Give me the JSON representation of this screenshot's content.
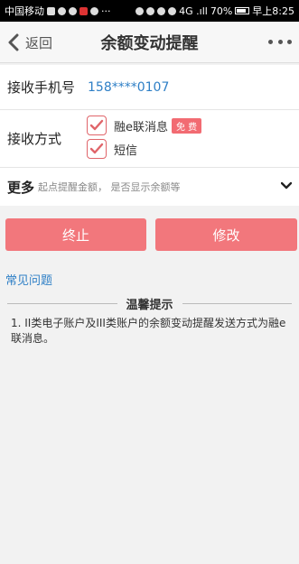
{
  "status_bar": {
    "carrier": "中国移动",
    "more": "···",
    "signal": "4G .ıll",
    "battery": "70%",
    "time": "早上8:25"
  },
  "nav": {
    "back_label": "返回",
    "title": "余额变动提醒",
    "more_icon": "more-dots-icon"
  },
  "phone": {
    "label": "接收手机号",
    "value": "158****0107"
  },
  "method": {
    "label": "接收方式",
    "options": [
      {
        "label": "融e联消息",
        "badge": "免 费",
        "checked": true
      },
      {
        "label": "短信",
        "checked": true
      }
    ]
  },
  "more": {
    "label": "更多",
    "hint": "起点提醒金额， 是否显示余额等"
  },
  "buttons": {
    "stop": "终止",
    "edit": "修改"
  },
  "faq": "常见问题",
  "tips": {
    "title": "温馨提示",
    "items": [
      "1. II类电子账户及III类账户的余额变动提醒发送方式为融e联消息。"
    ]
  },
  "colors": {
    "accent": "#f2777c",
    "link": "#2e7fc6",
    "badge": "#f26b72"
  }
}
